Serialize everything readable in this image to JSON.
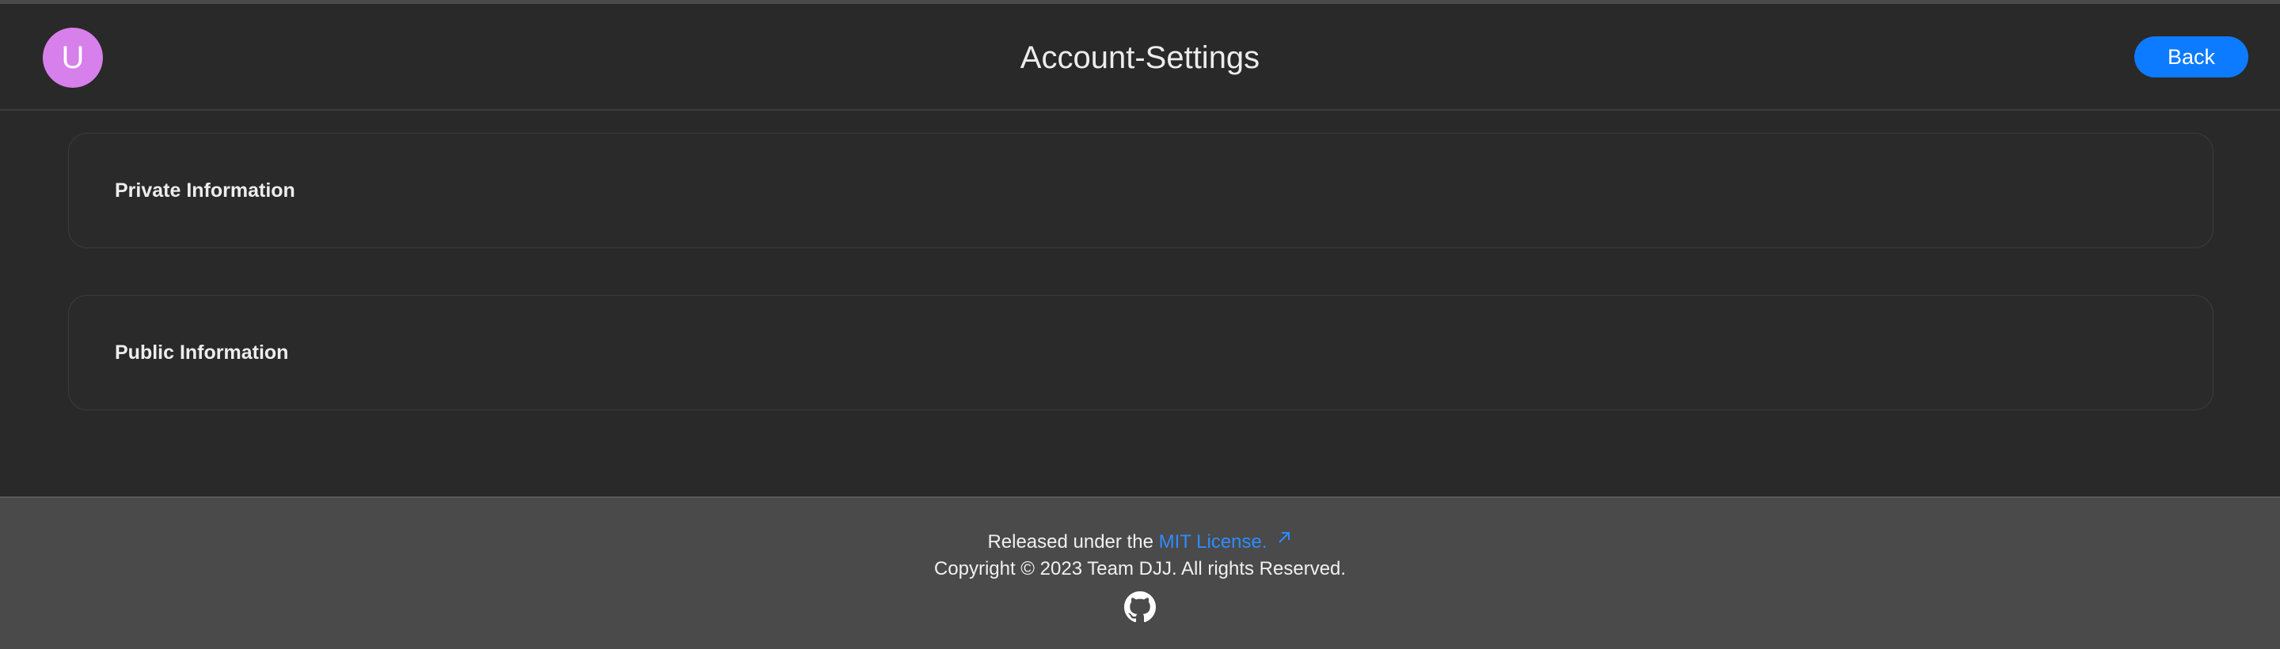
{
  "header": {
    "avatar_letter": "U",
    "title": "Account-Settings",
    "back_label": "Back"
  },
  "sections": [
    {
      "label": "Private Information"
    },
    {
      "label": "Public Information"
    }
  ],
  "footer": {
    "released_prefix": "Released under the ",
    "license_link": "MIT License.",
    "copyright": "Copyright © 2023 Team DJJ. All rights Reserved.",
    "github_icon": "github-icon"
  },
  "colors": {
    "background": "#292929",
    "footer_background": "#4a4a4a",
    "accent": "#0d7bff",
    "avatar": "#d77fea",
    "link": "#2d8cff"
  }
}
